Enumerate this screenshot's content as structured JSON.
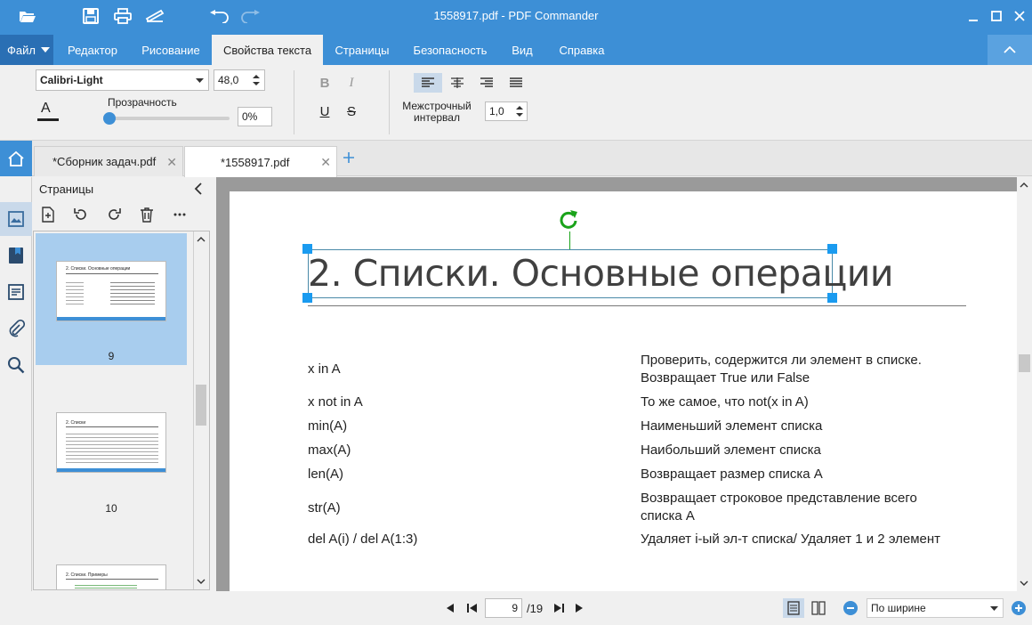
{
  "window": {
    "title": "1558917.pdf - PDF Commander"
  },
  "menu": {
    "file": "Файл",
    "tabs": [
      "Редактор",
      "Рисование",
      "Свойства текста",
      "Страницы",
      "Безопасность",
      "Вид",
      "Справка"
    ]
  },
  "ribbon": {
    "font": "Calibri-Light",
    "size": "48,0",
    "opacity_label": "Прозрачность",
    "opacity_value": "0%",
    "opacity_level": 0,
    "color_letter": "A",
    "bold": "B",
    "italic": "I",
    "underline": "U",
    "strike": "S",
    "line_spacing_label_1": "Межстрочный",
    "line_spacing_label_2": "интервал",
    "line_spacing_value": "1,0"
  },
  "doc_tabs": [
    {
      "label": "*Сборник задач.pdf"
    },
    {
      "label": "*1558917.pdf"
    }
  ],
  "pages_panel": {
    "title": "Страницы",
    "thumbs": [
      {
        "num": "9",
        "caption": "2. Списки. Основные операции"
      },
      {
        "num": "10",
        "caption": "2. Списки"
      },
      {
        "num": "",
        "caption": "2. Списки. Примеры"
      }
    ]
  },
  "document": {
    "heading": "2. Списки. Основные операции",
    "rows": [
      {
        "op": "x in A",
        "desc1": "Проверить, содержится ли элемент в списке.",
        "desc2": "Возвращает True или False"
      },
      {
        "op": "x not in A",
        "desc1": "То же самое, что not(x in A)",
        "desc2": ""
      },
      {
        "op": "min(A)",
        "desc1": "Наименьший элемент списка",
        "desc2": ""
      },
      {
        "op": "max(A)",
        "desc1": "Наибольший элемент списка",
        "desc2": ""
      },
      {
        "op": "len(A)",
        "desc1": "Возвращает размер списка A",
        "desc2": ""
      },
      {
        "op": "str(A)",
        "desc1": "Возвращает строковое представление всего",
        "desc2": "списка A"
      },
      {
        "op": "del A(i) / del A(1:3)",
        "desc1": "Удаляет i-ый эл-т списка/ Удаляет 1 и 2 элемент",
        "desc2": ""
      }
    ]
  },
  "status": {
    "page": "9",
    "total": "/19",
    "zoom": "По ширине"
  },
  "colors": {
    "accent": "#3d8fd6",
    "handle": "#1a9bf0",
    "rotate": "#1aa31a"
  }
}
